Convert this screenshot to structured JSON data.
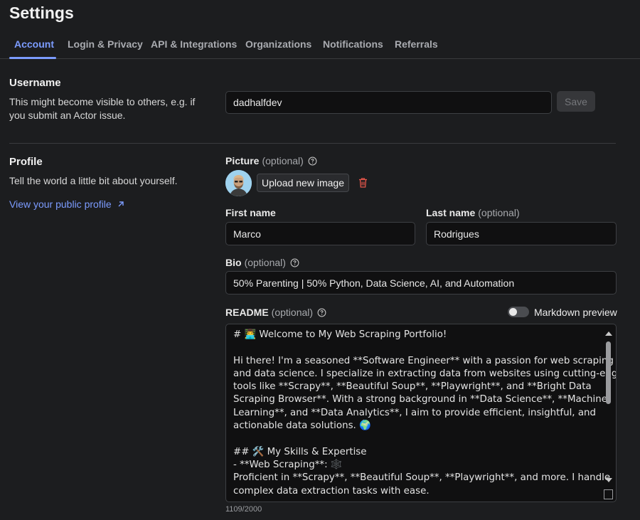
{
  "page": {
    "title": "Settings"
  },
  "tabs": [
    {
      "label": "Account",
      "active": true
    },
    {
      "label": "Login & Privacy"
    },
    {
      "label": "API & Integrations"
    },
    {
      "label": "Organizations"
    },
    {
      "label": "Notifications"
    },
    {
      "label": "Referrals"
    }
  ],
  "username": {
    "title": "Username",
    "description_line1": "This might become visible to others, e.g. if",
    "description_line2": "you submit an Actor issue.",
    "value": "dadhalfdev",
    "save_label": "Save"
  },
  "profile": {
    "title": "Profile",
    "description": "Tell the world a little bit about yourself.",
    "public_profile_link": "View your public profile",
    "picture_label": "Picture",
    "optional": "(optional)",
    "upload_label": "Upload new image",
    "first_name_label": "First name",
    "first_name_value": "Marco",
    "last_name_label": "Last name",
    "last_name_value": "Rodrigues",
    "bio_label": "Bio",
    "bio_value": "50% Parenting | 50% Python, Data Science, AI, and Automation",
    "readme_label": "README",
    "markdown_preview_label": "Markdown preview",
    "markdown_preview_on": false,
    "readme_lines": [
      "# 👨‍💻 Welcome to My Web Scraping Portfolio!",
      "",
      "Hi there! I'm a seasoned **Software Engineer** with a passion for web scraping",
      "and data science. I specialize in extracting data from websites using cutting-edge",
      "tools like **Scrapy**, **Beautiful Soup**, **Playwright**, and **Bright Data",
      "Scraping Browser**. With a strong background in **Data Science**, **Machine",
      "Learning**, and **Data Analytics**, I aim to provide efficient, insightful, and",
      "actionable data solutions. 🌍",
      "",
      "## 🛠️ My Skills & Expertise",
      "- **Web Scraping**: 🕸️",
      "  Proficient in **Scrapy**, **Beautiful Soup**, **Playwright**, and more. I handle",
      "complex data extraction tasks with ease."
    ],
    "char_count": "1109/2000"
  },
  "icons": {
    "info": "info-circle-icon",
    "external": "arrow-up-right-icon",
    "trash": "trash-icon",
    "trash_color": "#e5564a",
    "accent": "#7c9cff"
  }
}
